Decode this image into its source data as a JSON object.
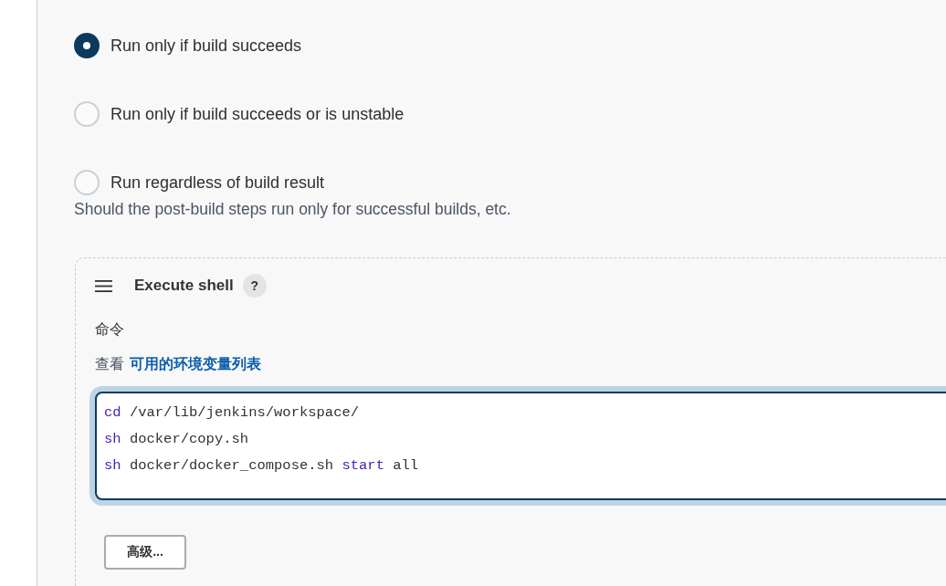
{
  "run_condition": {
    "options": [
      {
        "label": "Run only if build succeeds",
        "selected": true
      },
      {
        "label": "Run only if build succeeds or is unstable",
        "selected": false
      },
      {
        "label": "Run regardless of build result",
        "selected": false
      }
    ],
    "help_text": "Should the post-build steps run only for successful builds, etc."
  },
  "build_step": {
    "title": "Execute shell",
    "help_button": "?",
    "command_label": "命令",
    "env_hint": {
      "prefix": "查看",
      "link": "可用的环境变量列表"
    },
    "command_lines": [
      {
        "tokens": [
          {
            "kind": "keyword",
            "text": "cd"
          },
          {
            "kind": "plain",
            "text": "/var/lib/jenkins/workspace/"
          }
        ]
      },
      {
        "tokens": [
          {
            "kind": "keyword",
            "text": "sh"
          },
          {
            "kind": "plain",
            "text": "docker/copy.sh"
          }
        ]
      },
      {
        "tokens": [
          {
            "kind": "keyword",
            "text": "sh"
          },
          {
            "kind": "plain",
            "text": "docker/docker_compose.sh"
          },
          {
            "kind": "keyword",
            "text": "start"
          },
          {
            "kind": "plain",
            "text": "all"
          }
        ]
      }
    ],
    "advanced_button": "高级..."
  }
}
